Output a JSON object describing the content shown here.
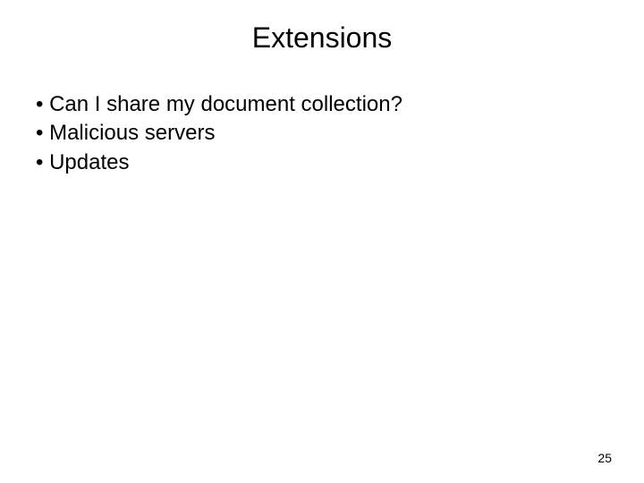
{
  "slide": {
    "title": "Extensions",
    "bullets": [
      "Can I share my document collection?",
      "Malicious servers",
      "Updates"
    ],
    "page_number": "25"
  }
}
